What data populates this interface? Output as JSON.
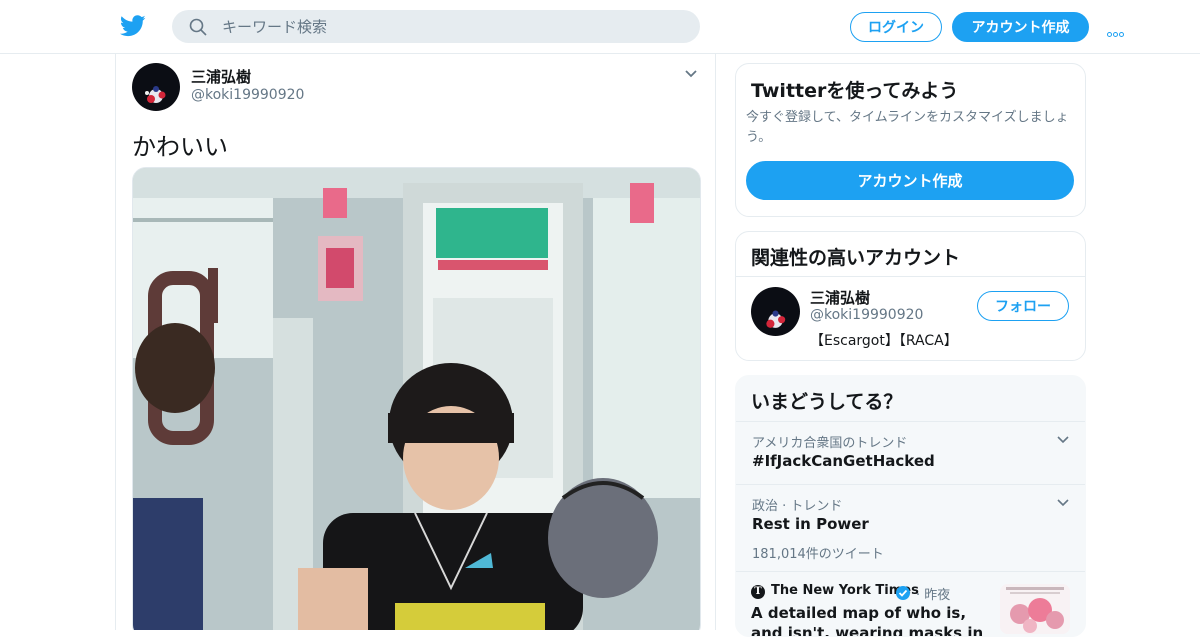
{
  "header": {
    "logo_icon": "twitter-bird-icon",
    "search_placeholder": "キーワード検索",
    "login_label": "ログイン",
    "signup_label": "アカウント作成",
    "more_icon": "more-dots-icon"
  },
  "tweet": {
    "name": "三浦弘樹",
    "handle": "@koki19990920",
    "text": "かわいい",
    "menu_icon": "chevron-down-icon",
    "photo_icon": "tweet-photo"
  },
  "signup_card": {
    "title": "Twitterを使ってみよう",
    "description": "今すぐ登録して、タイムラインをカスタマイズしましょう。",
    "button_label": "アカウント作成"
  },
  "related_card": {
    "title": "関連性の高いアカウント",
    "account": {
      "name": "三浦弘樹",
      "handle": "@koki19990920",
      "bio": "【Escargot】【RACA】",
      "follow_label": "フォロー"
    }
  },
  "trends_card": {
    "title": "いまどうしてる？",
    "items": [
      {
        "category": "アメリカ合衆国のトレンド",
        "name": "#IfJackCanGetHacked"
      },
      {
        "category": "政治 · トレンド",
        "name": "Rest in Power",
        "count": "181,014件のツイート"
      }
    ],
    "news": {
      "source": "The New York Times",
      "time": "· 昨夜",
      "headline": "A detailed map of who is, and isn't, wearing masks in the U.S."
    }
  },
  "colors": {
    "accent": "#1da1f2",
    "border": "#e6ecf0",
    "secondary_text": "#657786"
  }
}
